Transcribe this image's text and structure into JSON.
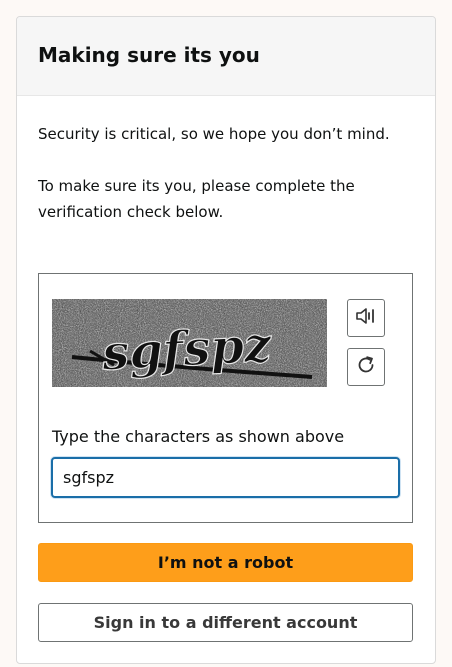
{
  "header": {
    "title": "Making sure its you"
  },
  "body": {
    "intro": "Security is critical, so we hope you don’t mind.",
    "instruction": "To make sure its you, please complete the verification check below."
  },
  "captcha": {
    "image_text": "sgfspz",
    "audio_icon": "speaker-icon",
    "refresh_icon": "refresh-icon",
    "input_label": "Type the characters as shown above",
    "input_value": "sgfspz"
  },
  "actions": {
    "submit_label": "I’m not a robot",
    "switch_account_label": "Sign in to a different account"
  },
  "colors": {
    "primary_button": "#fe9e1a",
    "input_focus_border": "#1a6ea8",
    "header_background": "#f6f6f6"
  }
}
